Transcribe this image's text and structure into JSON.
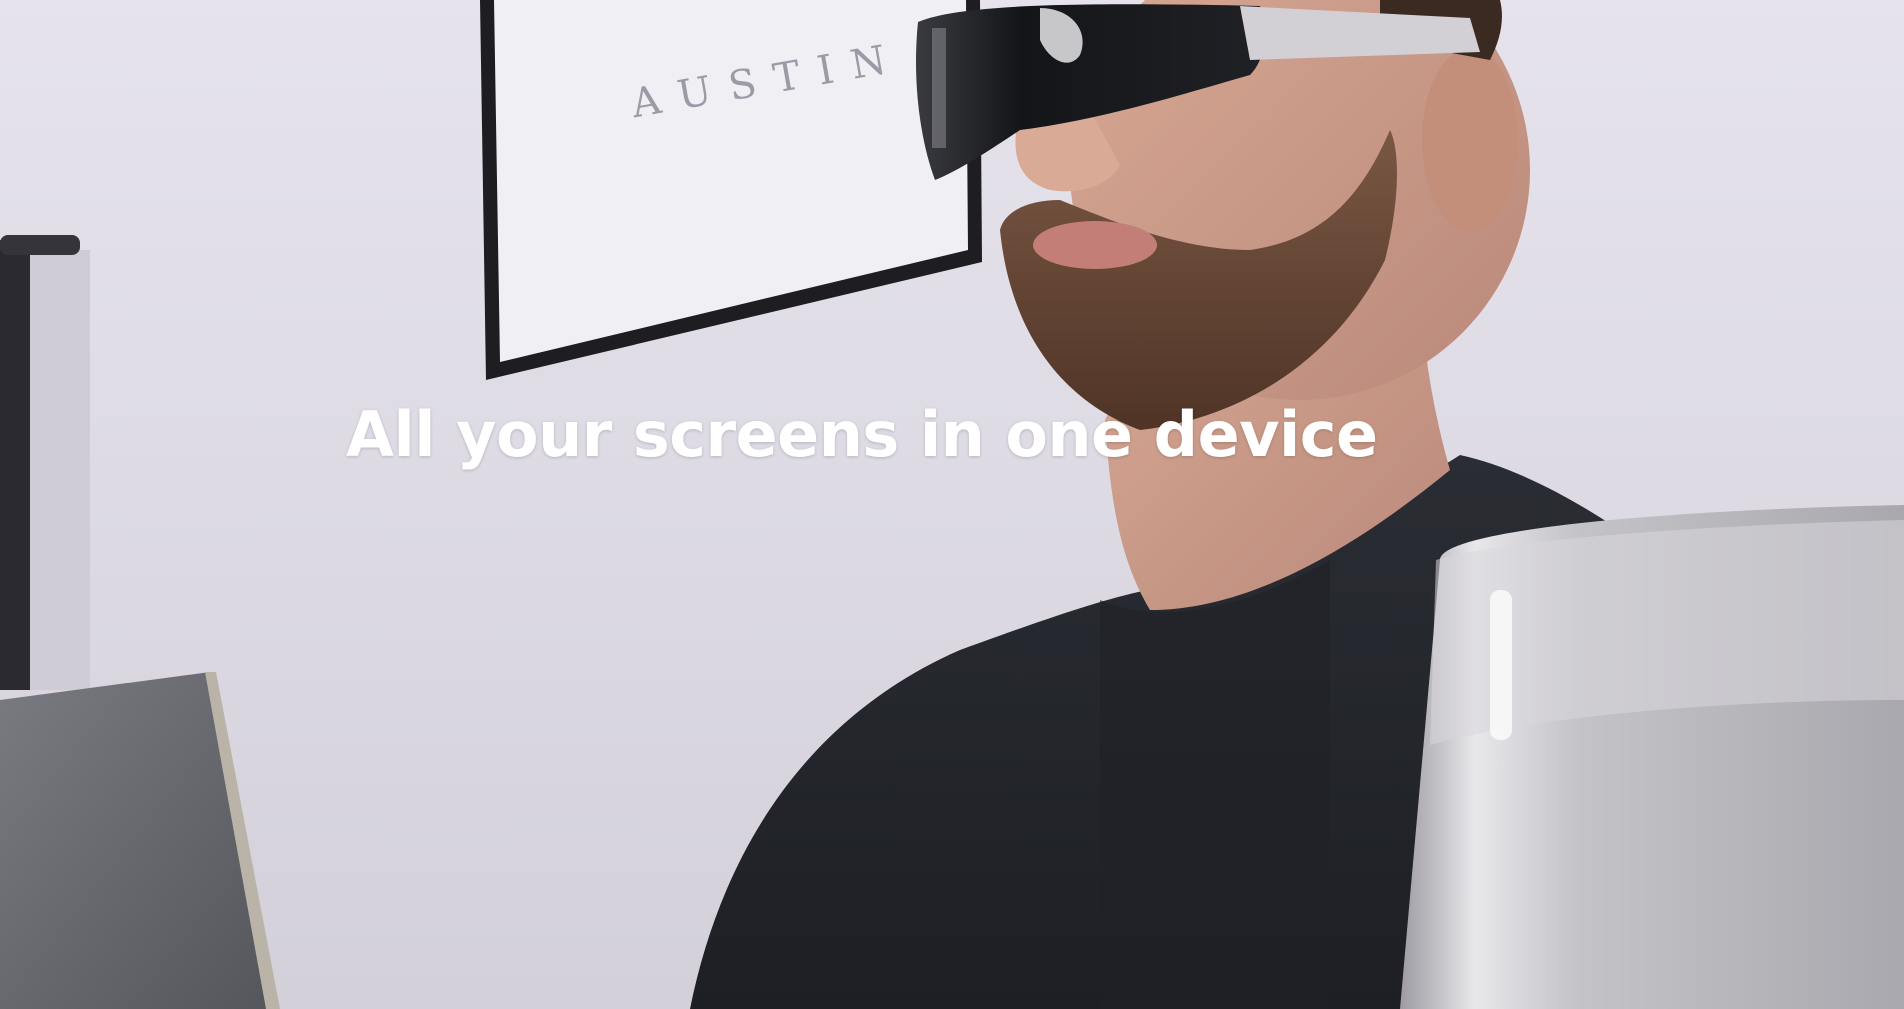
{
  "video_frame": {
    "caption": "All your screens in one device",
    "poster_text": "AUSTIN"
  },
  "colors": {
    "wall": "#e4e1ea",
    "shirt": "#24262d",
    "beard": "#6a4a38",
    "skin": "#c99a86",
    "visor": "#1c1d22",
    "laptop": "#6e6f75",
    "mug": "#b9b8bd"
  }
}
